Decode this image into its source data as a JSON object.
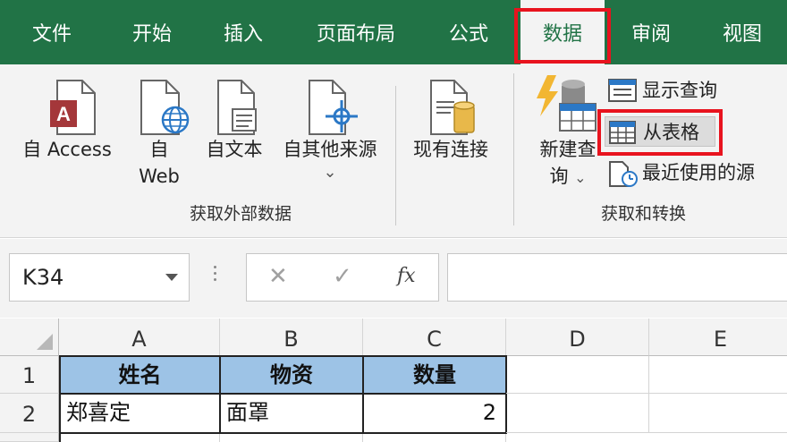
{
  "tabs": [
    {
      "label": "文件"
    },
    {
      "label": "开始"
    },
    {
      "label": "插入"
    },
    {
      "label": "页面布局"
    },
    {
      "label": "公式"
    },
    {
      "label": "数据",
      "active": true
    },
    {
      "label": "审阅"
    },
    {
      "label": "视图"
    }
  ],
  "ribbon": {
    "get_external": {
      "access_label": "自 Access",
      "web_label_line1": "自",
      "web_label_line2": "Web",
      "text_label": "自文本",
      "other_label": "自其他来源",
      "other_caret": "⌄",
      "group_label": "获取外部数据"
    },
    "existing_label": "现有连接",
    "get_transform": {
      "new_query_line1": "新建查",
      "new_query_line2": "询",
      "new_query_caret": "⌄",
      "show_queries_label": "显示查询",
      "from_table_label": "从表格",
      "recent_sources_label": "最近使用的源",
      "group_label": "获取和转换"
    }
  },
  "formula_bar": {
    "name_box_value": "K34",
    "cancel_glyph": "✕",
    "enter_glyph": "✓",
    "fx_label": "fx",
    "formula_value": ""
  },
  "grid": {
    "columns": [
      "A",
      "B",
      "C",
      "D",
      "E"
    ],
    "rows": [
      "1",
      "2"
    ],
    "header_row": [
      "姓名",
      "物资",
      "数量"
    ],
    "data_rows": [
      [
        "郑喜定",
        "面罩",
        "2"
      ]
    ]
  },
  "colors": {
    "brand_green": "#217346",
    "highlight_red": "#e8131e",
    "header_fill": "#9dc3e6"
  }
}
